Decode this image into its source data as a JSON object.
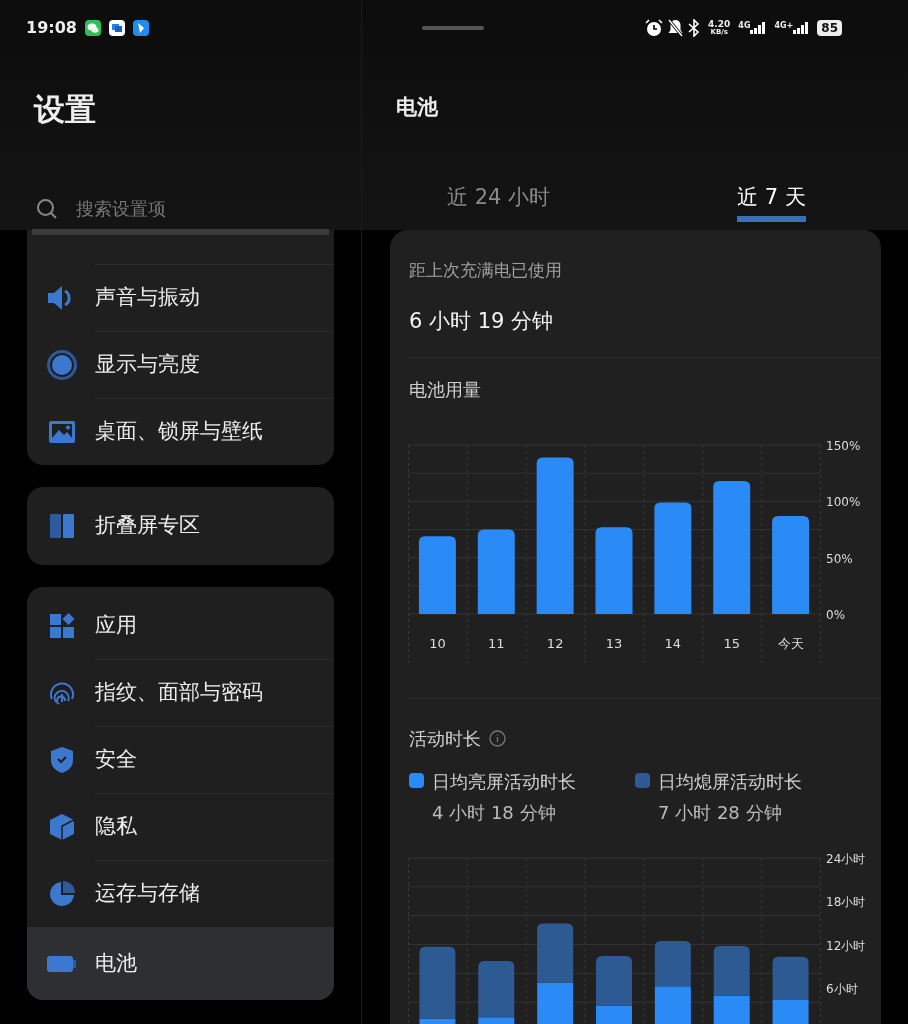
{
  "status_bar": {
    "time": "19:08",
    "net_speed": "4.20",
    "net_unit": "KB/s",
    "sim1": "4G",
    "sim2": "4G+",
    "battery": "85"
  },
  "sidebar": {
    "title": "设置",
    "search": {
      "placeholder": "搜索设置项"
    },
    "groups": [
      {
        "items": [
          {
            "label": "声音与振动",
            "selected": false
          },
          {
            "label": "显示与亮度",
            "selected": false
          },
          {
            "label": "桌面、锁屏与壁纸",
            "selected": false
          }
        ]
      },
      {
        "items": [
          {
            "label": "折叠屏专区",
            "selected": false
          }
        ]
      },
      {
        "items": [
          {
            "label": "应用",
            "selected": false
          },
          {
            "label": "指纹、面部与密码",
            "selected": false
          },
          {
            "label": "安全",
            "selected": false
          },
          {
            "label": "隐私",
            "selected": false
          },
          {
            "label": "运存与存储",
            "selected": false
          },
          {
            "label": "电池",
            "selected": true
          }
        ]
      }
    ]
  },
  "detail": {
    "title": "电池",
    "tabs": [
      {
        "label": "近 24 小时",
        "selected": false
      },
      {
        "label": "近 7 天",
        "selected": true
      }
    ],
    "since_full_label": "距上次充满电已使用",
    "since_full_value": "6 小时 19 分钟",
    "usage": {
      "title": "电池用量",
      "chart_data": {
        "type": "bar",
        "categories": [
          "10",
          "11",
          "12",
          "13",
          "14",
          "15",
          "今天"
        ],
        "series": [
          {
            "color": "#2a8af6",
            "values": [
              69,
              75,
              139,
              77,
              99,
              118,
              87
            ]
          }
        ],
        "ylim": [
          0,
          150
        ],
        "yticks": [
          {
            "value": 0,
            "label": "0%"
          },
          {
            "value": 50,
            "label": "50%"
          },
          {
            "value": 100,
            "label": "100%"
          },
          {
            "value": 150,
            "label": "150%"
          }
        ]
      }
    },
    "activity": {
      "title": "活动时长",
      "legend": [
        {
          "value": "4 小时 18 分钟"
        },
        {
          "value": "7 小时 28 分钟"
        }
      ],
      "chart_data": {
        "type": "bar",
        "stacked": true,
        "series": [
          {
            "name": "日均亮屏活动时长",
            "color": "#2a8af6",
            "values": [
              1.7,
              1.9,
              6.7,
              3.5,
              6.2,
              4.9,
              4.3
            ]
          },
          {
            "name": "日均熄屏活动时长",
            "color": "#2e5a93",
            "values": [
              10.0,
              7.8,
              8.2,
              6.9,
              6.3,
              6.9,
              6.0
            ]
          }
        ],
        "ylim": [
          0,
          24
        ],
        "yticks": [
          {
            "value": 6,
            "label": "6小时"
          },
          {
            "value": 12,
            "label": "12小时"
          },
          {
            "value": 18,
            "label": "18小时"
          },
          {
            "value": 24,
            "label": "24小时"
          }
        ]
      }
    }
  }
}
